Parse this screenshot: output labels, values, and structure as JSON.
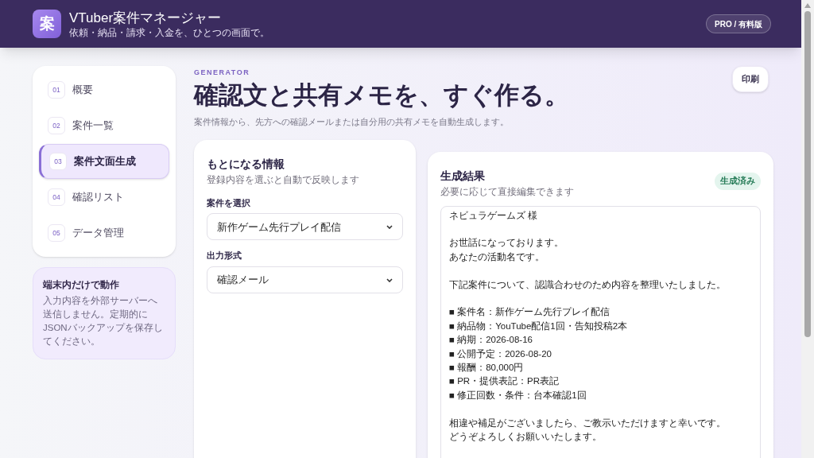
{
  "header": {
    "logo": "案",
    "title": "VTuber案件マネージャー",
    "subtitle": "依頼・納品・請求・入金を、ひとつの画面で。",
    "plan_badge": "PRO / 有料版"
  },
  "sidebar": {
    "items": [
      {
        "number": "01",
        "label": "概要",
        "selected": false
      },
      {
        "number": "02",
        "label": "案件一覧",
        "selected": false
      },
      {
        "number": "03",
        "label": "案件文面生成",
        "selected": true
      },
      {
        "number": "04",
        "label": "確認リスト",
        "selected": false
      },
      {
        "number": "05",
        "label": "データ管理",
        "selected": false
      }
    ],
    "notice": {
      "title": "端末内だけで動作",
      "body": "入力内容を外部サーバーへ送信しません。定期的にJSONバックアップを保存してください。"
    }
  },
  "page": {
    "eyebrow": "GENERATOR",
    "title": "確認文と共有メモを、すぐ作る。",
    "description": "案件情報から、先方への確認メールまたは自分用の共有メモを自動生成します。",
    "print_button": "印刷"
  },
  "source_panel": {
    "title": "もとになる情報",
    "subtitle": "登録内容を選ぶと自動で反映します",
    "fields": [
      {
        "label": "案件を選択",
        "value": "新作ゲーム先行プレイ配信"
      },
      {
        "label": "出力形式",
        "value": "確認メール"
      }
    ]
  },
  "result_panel": {
    "title": "生成結果",
    "subtitle": "必要に応じて直接編集できます",
    "status": "生成済み",
    "paragraphs": [
      [
        "ネビュラゲームズ 様"
      ],
      [
        "お世話になっております。",
        "あなたの活動名です。"
      ],
      [
        "下記案件について、認識合わせのため内容を整理いたしました。"
      ],
      [
        "■ 案件名：新作ゲーム先行プレイ配信",
        "■ 納品物：YouTube配信1回・告知投稿2本",
        "■ 納期：2026-08-16",
        "■ 公開予定：2026-08-20",
        "■ 報酬：80,000円",
        "■ PR・提供表記：PR表記",
        "■ 修正回数・条件：台本確認1回"
      ],
      [
        "相違や補足がございましたら、ご教示いただけますと幸いです。",
        "どうぞよろしくお願いいたします。"
      ]
    ]
  }
}
